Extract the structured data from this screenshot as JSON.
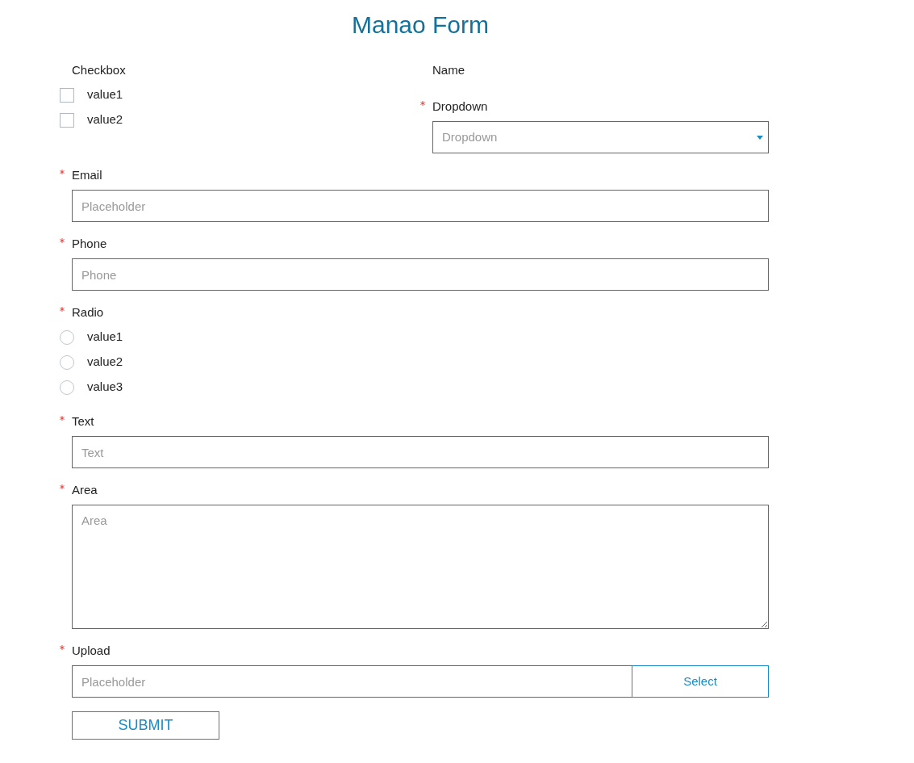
{
  "title": "Manao Form",
  "top_left": [
    {
      "kind": "checkbox",
      "label": "Checkbox",
      "required": false,
      "options": [
        {
          "label": "value1",
          "checked": false
        },
        {
          "label": "value2",
          "checked": false
        }
      ]
    }
  ],
  "top_right": [
    {
      "kind": "label",
      "label": "Name",
      "required": false
    },
    {
      "kind": "select",
      "label": "Dropdown",
      "required": true,
      "placeholder": "Dropdown"
    }
  ],
  "fields": [
    {
      "kind": "input",
      "label": "Email",
      "required": true,
      "placeholder": "Placeholder"
    },
    {
      "kind": "input",
      "label": "Phone",
      "required": true,
      "placeholder": "Phone"
    },
    {
      "kind": "radio",
      "label": "Radio",
      "required": true,
      "options": [
        {
          "label": "value1",
          "selected": false
        },
        {
          "label": "value2",
          "selected": false
        },
        {
          "label": "value3",
          "selected": false
        }
      ]
    },
    {
      "kind": "input",
      "label": "Text",
      "required": true,
      "placeholder": "Text"
    },
    {
      "kind": "textarea",
      "label": "Area",
      "required": true,
      "placeholder": "Area"
    },
    {
      "kind": "upload",
      "label": "Upload",
      "required": true,
      "placeholder": "Placeholder",
      "button": "Select"
    }
  ],
  "submit": "SUBMIT"
}
